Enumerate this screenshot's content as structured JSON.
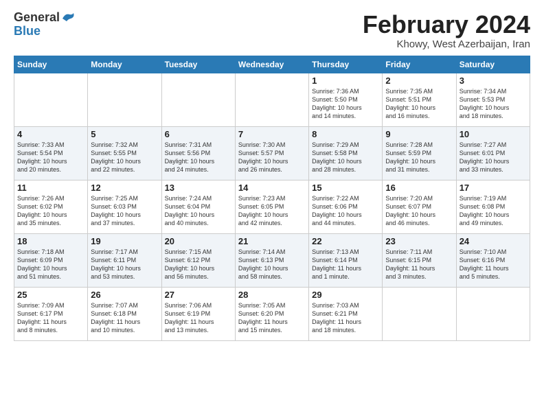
{
  "logo": {
    "general": "General",
    "blue": "Blue"
  },
  "title": "February 2024",
  "subtitle": "Khowy, West Azerbaijan, Iran",
  "days_of_week": [
    "Sunday",
    "Monday",
    "Tuesday",
    "Wednesday",
    "Thursday",
    "Friday",
    "Saturday"
  ],
  "weeks": [
    [
      {
        "day": "",
        "info": ""
      },
      {
        "day": "",
        "info": ""
      },
      {
        "day": "",
        "info": ""
      },
      {
        "day": "",
        "info": ""
      },
      {
        "day": "1",
        "info": "Sunrise: 7:36 AM\nSunset: 5:50 PM\nDaylight: 10 hours\nand 14 minutes."
      },
      {
        "day": "2",
        "info": "Sunrise: 7:35 AM\nSunset: 5:51 PM\nDaylight: 10 hours\nand 16 minutes."
      },
      {
        "day": "3",
        "info": "Sunrise: 7:34 AM\nSunset: 5:53 PM\nDaylight: 10 hours\nand 18 minutes."
      }
    ],
    [
      {
        "day": "4",
        "info": "Sunrise: 7:33 AM\nSunset: 5:54 PM\nDaylight: 10 hours\nand 20 minutes."
      },
      {
        "day": "5",
        "info": "Sunrise: 7:32 AM\nSunset: 5:55 PM\nDaylight: 10 hours\nand 22 minutes."
      },
      {
        "day": "6",
        "info": "Sunrise: 7:31 AM\nSunset: 5:56 PM\nDaylight: 10 hours\nand 24 minutes."
      },
      {
        "day": "7",
        "info": "Sunrise: 7:30 AM\nSunset: 5:57 PM\nDaylight: 10 hours\nand 26 minutes."
      },
      {
        "day": "8",
        "info": "Sunrise: 7:29 AM\nSunset: 5:58 PM\nDaylight: 10 hours\nand 28 minutes."
      },
      {
        "day": "9",
        "info": "Sunrise: 7:28 AM\nSunset: 5:59 PM\nDaylight: 10 hours\nand 31 minutes."
      },
      {
        "day": "10",
        "info": "Sunrise: 7:27 AM\nSunset: 6:01 PM\nDaylight: 10 hours\nand 33 minutes."
      }
    ],
    [
      {
        "day": "11",
        "info": "Sunrise: 7:26 AM\nSunset: 6:02 PM\nDaylight: 10 hours\nand 35 minutes."
      },
      {
        "day": "12",
        "info": "Sunrise: 7:25 AM\nSunset: 6:03 PM\nDaylight: 10 hours\nand 37 minutes."
      },
      {
        "day": "13",
        "info": "Sunrise: 7:24 AM\nSunset: 6:04 PM\nDaylight: 10 hours\nand 40 minutes."
      },
      {
        "day": "14",
        "info": "Sunrise: 7:23 AM\nSunset: 6:05 PM\nDaylight: 10 hours\nand 42 minutes."
      },
      {
        "day": "15",
        "info": "Sunrise: 7:22 AM\nSunset: 6:06 PM\nDaylight: 10 hours\nand 44 minutes."
      },
      {
        "day": "16",
        "info": "Sunrise: 7:20 AM\nSunset: 6:07 PM\nDaylight: 10 hours\nand 46 minutes."
      },
      {
        "day": "17",
        "info": "Sunrise: 7:19 AM\nSunset: 6:08 PM\nDaylight: 10 hours\nand 49 minutes."
      }
    ],
    [
      {
        "day": "18",
        "info": "Sunrise: 7:18 AM\nSunset: 6:09 PM\nDaylight: 10 hours\nand 51 minutes."
      },
      {
        "day": "19",
        "info": "Sunrise: 7:17 AM\nSunset: 6:11 PM\nDaylight: 10 hours\nand 53 minutes."
      },
      {
        "day": "20",
        "info": "Sunrise: 7:15 AM\nSunset: 6:12 PM\nDaylight: 10 hours\nand 56 minutes."
      },
      {
        "day": "21",
        "info": "Sunrise: 7:14 AM\nSunset: 6:13 PM\nDaylight: 10 hours\nand 58 minutes."
      },
      {
        "day": "22",
        "info": "Sunrise: 7:13 AM\nSunset: 6:14 PM\nDaylight: 11 hours\nand 1 minute."
      },
      {
        "day": "23",
        "info": "Sunrise: 7:11 AM\nSunset: 6:15 PM\nDaylight: 11 hours\nand 3 minutes."
      },
      {
        "day": "24",
        "info": "Sunrise: 7:10 AM\nSunset: 6:16 PM\nDaylight: 11 hours\nand 5 minutes."
      }
    ],
    [
      {
        "day": "25",
        "info": "Sunrise: 7:09 AM\nSunset: 6:17 PM\nDaylight: 11 hours\nand 8 minutes."
      },
      {
        "day": "26",
        "info": "Sunrise: 7:07 AM\nSunset: 6:18 PM\nDaylight: 11 hours\nand 10 minutes."
      },
      {
        "day": "27",
        "info": "Sunrise: 7:06 AM\nSunset: 6:19 PM\nDaylight: 11 hours\nand 13 minutes."
      },
      {
        "day": "28",
        "info": "Sunrise: 7:05 AM\nSunset: 6:20 PM\nDaylight: 11 hours\nand 15 minutes."
      },
      {
        "day": "29",
        "info": "Sunrise: 7:03 AM\nSunset: 6:21 PM\nDaylight: 11 hours\nand 18 minutes."
      },
      {
        "day": "",
        "info": ""
      },
      {
        "day": "",
        "info": ""
      }
    ]
  ]
}
